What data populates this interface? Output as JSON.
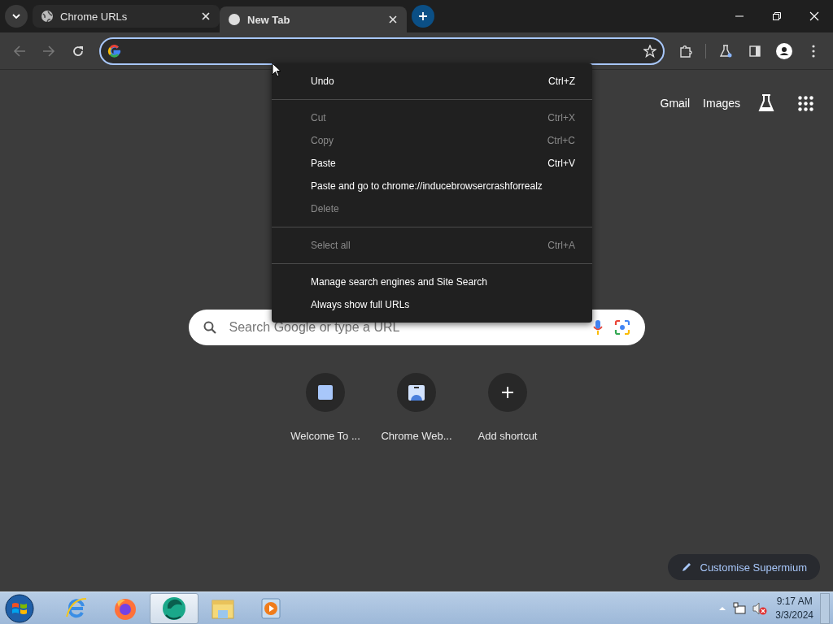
{
  "tabs": [
    {
      "title": "Chrome URLs",
      "selected": false,
      "kind": "globe"
    },
    {
      "title": "New Tab",
      "selected": true,
      "kind": "blank"
    }
  ],
  "toolbar": {
    "back_disabled": true,
    "forward_disabled": true
  },
  "context_menu": [
    {
      "kind": "item",
      "label": "Undo",
      "shortcut": "Ctrl+Z",
      "disabled": false
    },
    {
      "kind": "separator"
    },
    {
      "kind": "item",
      "label": "Cut",
      "shortcut": "Ctrl+X",
      "disabled": true
    },
    {
      "kind": "item",
      "label": "Copy",
      "shortcut": "Ctrl+C",
      "disabled": true
    },
    {
      "kind": "item",
      "label": "Paste",
      "shortcut": "Ctrl+V",
      "disabled": false
    },
    {
      "kind": "item",
      "label": "Paste and go to chrome://inducebrowsercrashforrealz",
      "disabled": false
    },
    {
      "kind": "item",
      "label": "Delete",
      "disabled": true
    },
    {
      "kind": "separator"
    },
    {
      "kind": "item",
      "label": "Select all",
      "shortcut": "Ctrl+A",
      "disabled": true
    },
    {
      "kind": "separator"
    },
    {
      "kind": "item",
      "label": "Manage search engines and Site Search",
      "disabled": false
    },
    {
      "kind": "item",
      "label": "Always show full URLs",
      "disabled": false
    }
  ],
  "header_links": [
    "Gmail",
    "Images"
  ],
  "search": {
    "placeholder": "Search Google or type a URL"
  },
  "shortcuts": [
    {
      "title": "Welcome To ...",
      "kind": "square"
    },
    {
      "title": "Chrome Web...",
      "kind": "store"
    },
    {
      "title": "Add shortcut",
      "kind": "add"
    }
  ],
  "customise_button": "Customise Supermium",
  "taskbar": {
    "apps": [
      {
        "kind": "ie",
        "selected": false
      },
      {
        "kind": "firefox",
        "selected": false
      },
      {
        "kind": "supermium",
        "selected": true
      },
      {
        "kind": "files",
        "selected": false
      },
      {
        "kind": "media",
        "selected": false
      }
    ],
    "time": "9:17 AM",
    "date": "3/3/2024"
  }
}
